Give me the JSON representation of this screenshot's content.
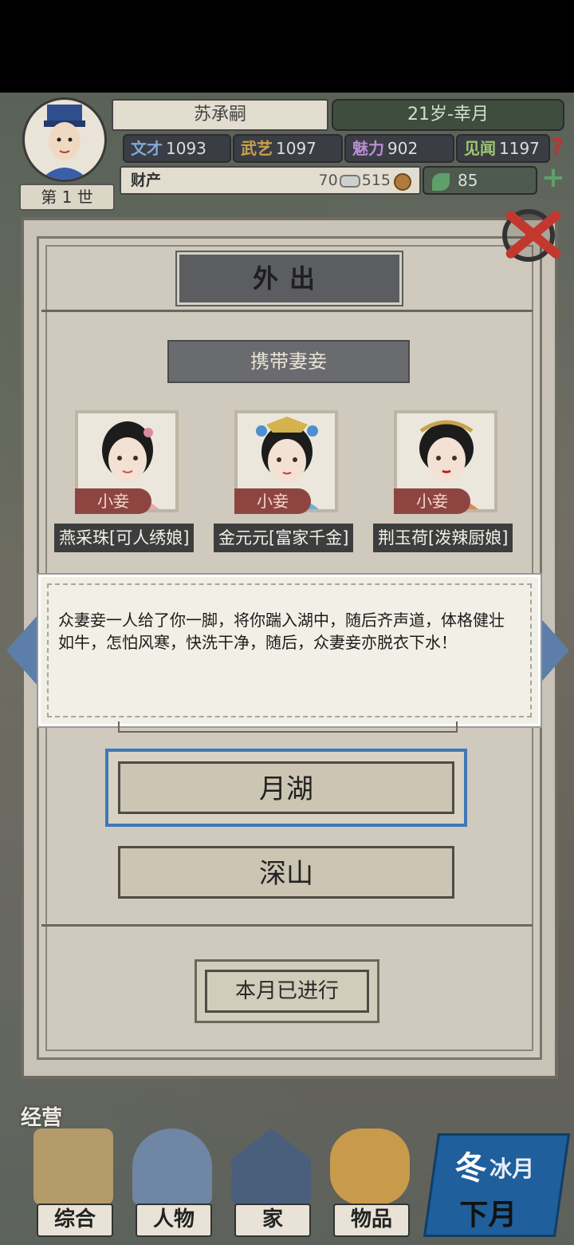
{
  "player": {
    "name": "苏承嗣",
    "age_month": "21岁-幸月",
    "generation": "第 1 世"
  },
  "stats": [
    {
      "key": "文才",
      "value": "1093",
      "color": "#7fa8d6"
    },
    {
      "key": "武艺",
      "value": "1097",
      "color": "#c9a24a"
    },
    {
      "key": "魅力",
      "value": "902",
      "color": "#b58fd1"
    },
    {
      "key": "见闻",
      "value": "1197",
      "color": "#9dc76f"
    }
  ],
  "help_icon": "?",
  "wealth": {
    "label": "财产",
    "silver": "70",
    "copper": "515"
  },
  "energy": {
    "value": "85"
  },
  "plus_icon": "+",
  "panel": {
    "title": "外出",
    "section": "携带妻妾",
    "consorts": [
      {
        "tag": "小妾",
        "name": "燕采珠[可人绣娘]"
      },
      {
        "tag": "小妾",
        "name": "金元元[富家千金]"
      },
      {
        "tag": "小妾",
        "name": "荆玉荷[泼辣厨娘]"
      }
    ],
    "dialog_text": "众妻妾一人给了你一脚，将你踹入湖中，随后齐声道，体格健壮如牛，怎怕风寒，快洗干净，随后，众妻妾亦脱衣下水！",
    "destinations": [
      "月湖",
      "深山"
    ],
    "done_label": "本月已进行"
  },
  "bottom": {
    "section_label": "经营",
    "nav": [
      "综合",
      "人物",
      "家",
      "物品"
    ],
    "season": "冬",
    "month": "冰月",
    "next": "下月"
  }
}
